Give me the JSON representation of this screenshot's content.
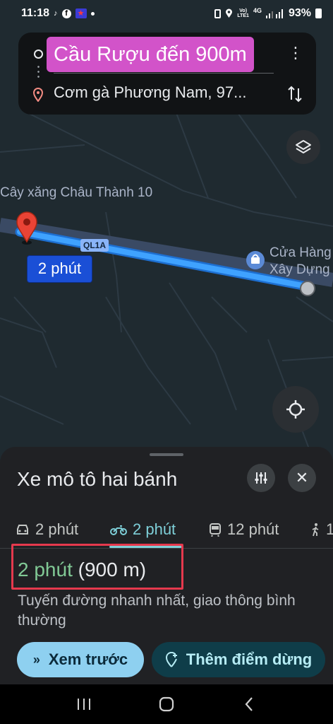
{
  "status_bar": {
    "time": "11:18",
    "left_icons": [
      "tiktok-icon",
      "facebook-icon",
      "app-notification-icon",
      "dot-icon"
    ],
    "right_icons": [
      "battery-saver-icon",
      "location-icon",
      "volte-icon",
      "4g-signal-icon",
      "signal-icon"
    ],
    "network_label": "4G",
    "battery": "93%"
  },
  "route_card": {
    "origin": "Cầu Rượu đến 900m",
    "destination": "Cơm gà Phương Nam, 97...",
    "menu_icon": "more-vertical-icon",
    "swap_icon": "swap-vertical-icon"
  },
  "map": {
    "labels": {
      "gas_station": "Cây xăng Châu Thành 10",
      "shop_line1": "Cửa Hàng",
      "shop_line2": "Xây Dựng"
    },
    "road_badge": "QL1A",
    "time_bubble": "2 phút",
    "route_color": "#3fa2ff",
    "road_color": "#3a4a64",
    "background_color": "#1f2a30"
  },
  "sheet": {
    "title": "Xe mô tô hai bánh",
    "tabs": [
      {
        "icon": "car-icon",
        "label": "2 phút",
        "active": false
      },
      {
        "icon": "motorbike-icon",
        "label": "2 phút",
        "active": true
      },
      {
        "icon": "transit-icon",
        "label": "12 phút",
        "active": false
      },
      {
        "icon": "walking-icon",
        "label": "1",
        "active": false
      }
    ],
    "duration_time": "2 phút",
    "duration_distance": "(900 m)",
    "description": "Tuyến đường nhanh nhất, giao thông bình thường",
    "preview_button": "Xem trước",
    "add_stop_button": "Thêm điểm dừng"
  },
  "colors": {
    "accent_teal": "#7ecfd8",
    "duration_green": "#81c995",
    "highlight_red": "#e5394d",
    "preview_bg": "#8ed0f0",
    "add_stop_bg": "#0f3d49"
  }
}
